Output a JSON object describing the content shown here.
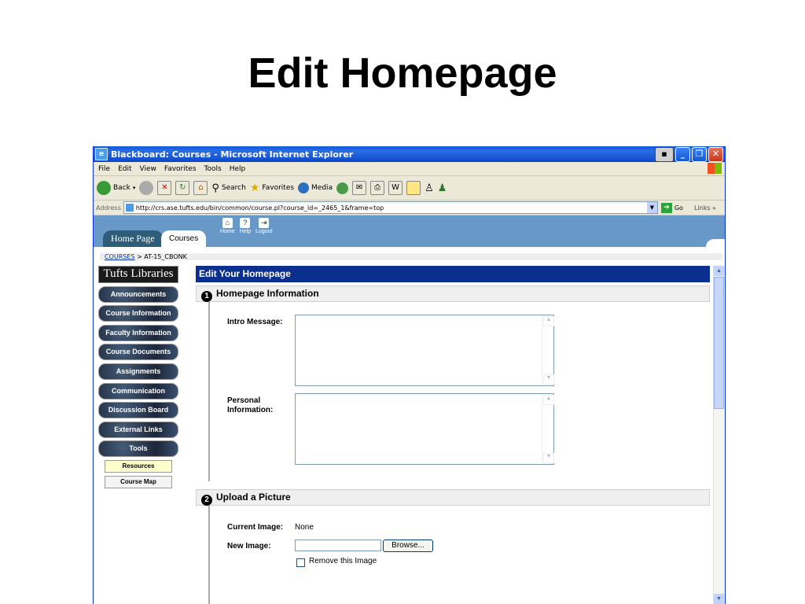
{
  "slide": {
    "title": "Edit Homepage"
  },
  "window": {
    "title": "Blackboard: Courses - Microsoft Internet Explorer",
    "menu": [
      "File",
      "Edit",
      "View",
      "Favorites",
      "Tools",
      "Help"
    ],
    "toolbar": {
      "back": "Back",
      "search": "Search",
      "favorites": "Favorites",
      "media": "Media"
    },
    "address": {
      "label": "Address",
      "url": "http://crs.ase.tufts.edu/bin/common/course.pl?course_id=_2465_1&frame=top",
      "go": "Go",
      "links": "Links"
    }
  },
  "bb": {
    "tabs": {
      "home": "Home Page",
      "courses": "Courses"
    },
    "header_links": {
      "home": "Home",
      "help": "Help",
      "logout": "Logout"
    },
    "breadcrumb": {
      "root": "COURSES",
      "current": "> AT-15_CBONK"
    },
    "sidebar": {
      "title": "Tufts Libraries",
      "buttons": [
        "Announcements",
        "Course Information",
        "Faculty Information",
        "Course Documents",
        "Assignments",
        "Communication",
        "Discussion Board",
        "External Links",
        "Tools"
      ],
      "sub": [
        "Resources",
        "Course Map"
      ]
    },
    "main": {
      "page_title": "Edit Your Homepage",
      "section1": {
        "num": "1",
        "title": "Homepage Information"
      },
      "intro_label": "Intro Message:",
      "personal_label_1": "Personal",
      "personal_label_2": "Information:",
      "section2": {
        "num": "2",
        "title": "Upload a Picture"
      },
      "current_image_label": "Current Image:",
      "current_image_value": "None",
      "new_image_label": "New Image:",
      "browse": "Browse...",
      "remove_label": "Remove this Image"
    }
  }
}
